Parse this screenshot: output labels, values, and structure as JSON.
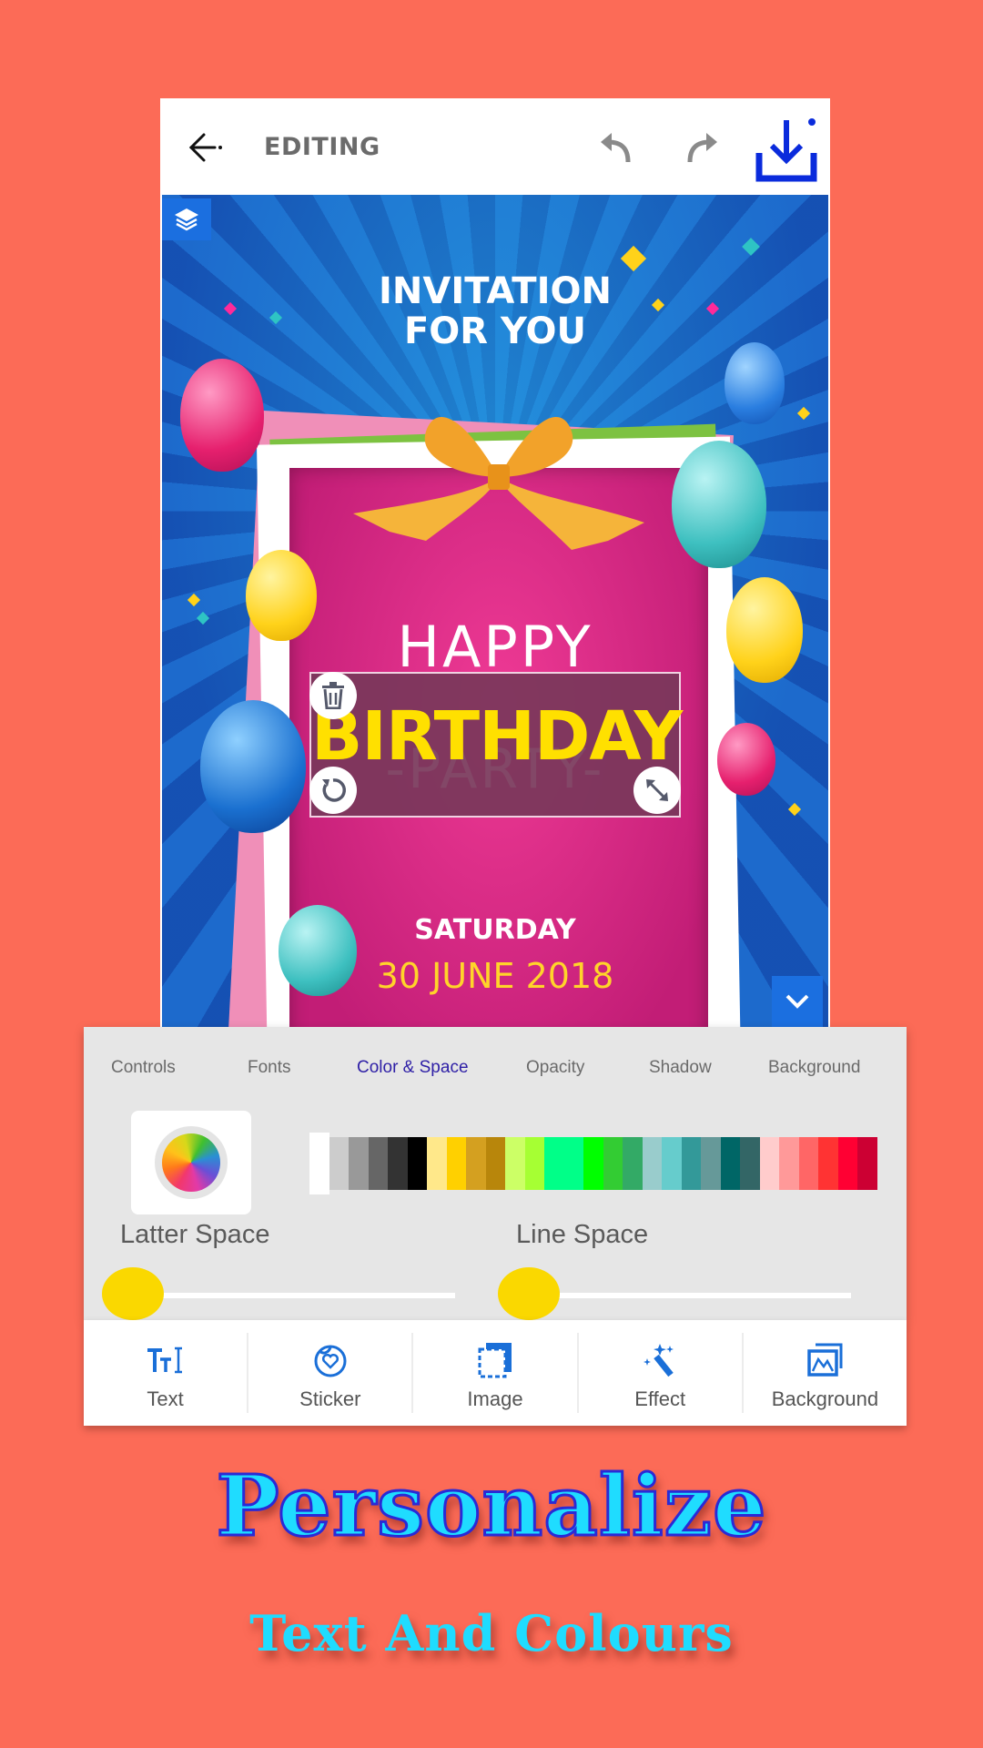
{
  "topbar": {
    "title": "EDITING",
    "icons": [
      "back-arrow-icon",
      "undo-icon",
      "redo-icon",
      "download-icon"
    ]
  },
  "canvas": {
    "layers_icon": "layers-icon",
    "heading_line1": "INVITATION",
    "heading_line2": "FOR YOU",
    "happy": "HAPPY",
    "selected_text": "BIRTHDAY",
    "party": "-PARTY-",
    "day": "SATURDAY",
    "date": "30 JUNE 2018",
    "selected_text_color": "#ffe000",
    "handles": [
      "delete-icon",
      "rotate-icon",
      "resize-icon"
    ],
    "collapse_icon": "chevron-down-icon"
  },
  "panel": {
    "tabs": [
      {
        "label": "Controls"
      },
      {
        "label": "Fonts"
      },
      {
        "label": "Color & Space",
        "active": true
      },
      {
        "label": "Opacity"
      },
      {
        "label": "Shadow"
      },
      {
        "label": "Background"
      }
    ],
    "color_picker_icon": "color-wheel-icon",
    "swatches": [
      "#ffffff",
      "#cccccc",
      "#999999",
      "#666666",
      "#333333",
      "#000000",
      "#ffe88a",
      "#ffd000",
      "#d4a020",
      "#b8860b",
      "#ccff66",
      "#a6ff33",
      "#00ff88",
      "#00ff88",
      "#00ff00",
      "#33cc33",
      "#33aa66",
      "#99cccc",
      "#66cccc",
      "#339999",
      "#669999",
      "#006666",
      "#336666",
      "#ffcccc",
      "#ff9999",
      "#ff6666",
      "#ff3333",
      "#ff0033",
      "#cc0033"
    ],
    "letter_space_label": "Latter Space",
    "letter_space_value": 0,
    "line_space_label": "Line Space",
    "line_space_value": 0,
    "slider_color": "#fad800"
  },
  "bottomnav": {
    "items": [
      {
        "label": "Text",
        "icon": "text-size-icon"
      },
      {
        "label": "Sticker",
        "icon": "sticker-icon"
      },
      {
        "label": "Image",
        "icon": "image-frame-icon"
      },
      {
        "label": "Effect",
        "icon": "magic-wand-icon"
      },
      {
        "label": "Background",
        "icon": "background-image-icon"
      }
    ]
  },
  "promo": {
    "headline": "Personalize",
    "subline": "Text And Colours"
  },
  "colors": {
    "page_background": "#fc6b57",
    "accent_blue": "#1b6fe0",
    "download_blue": "#0a2bdc",
    "active_tab": "#2e1fa6",
    "promo_text": "#1fdcff"
  }
}
